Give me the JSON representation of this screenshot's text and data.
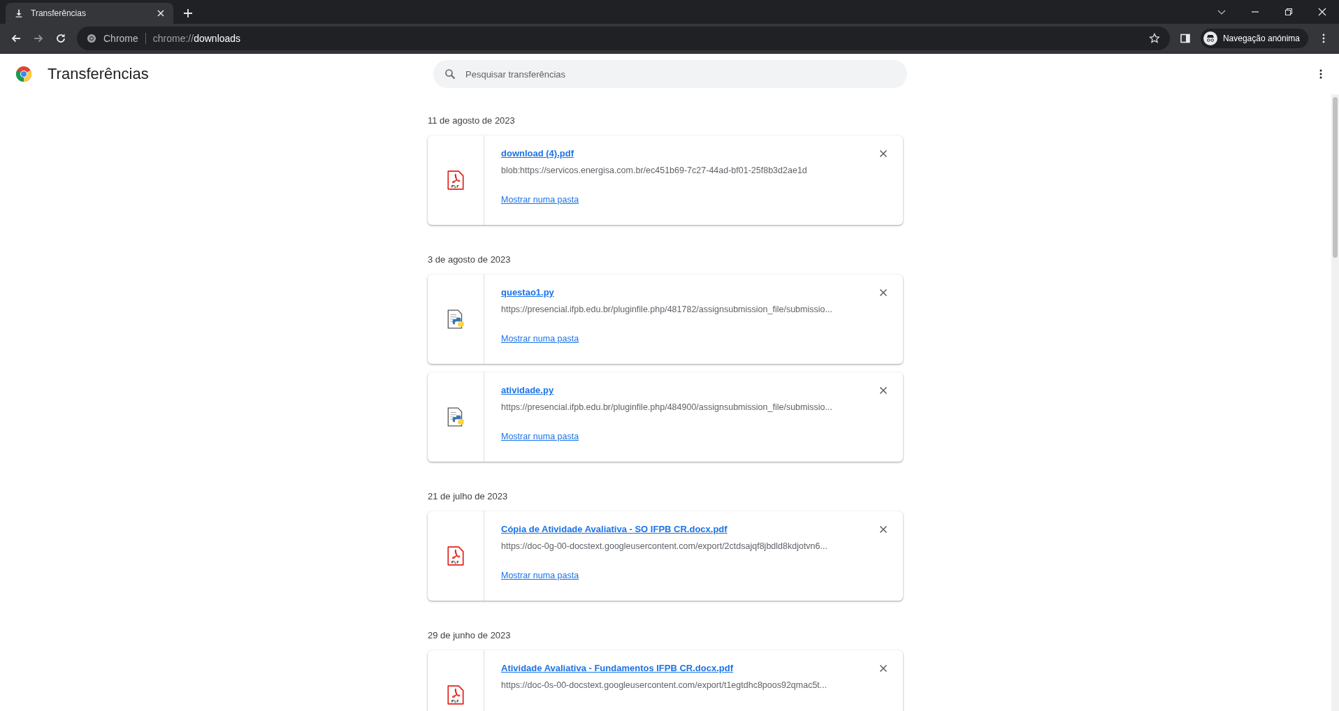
{
  "tab": {
    "title": "Transferências",
    "selected": true
  },
  "address": {
    "site": "Chrome",
    "scheme": "chrome://",
    "path": "downloads"
  },
  "profile": "Navegação anónima",
  "page": {
    "title": "Transferências",
    "search_placeholder": "Pesquisar transferências"
  },
  "groups": [
    {
      "date": "11 de agosto de 2023",
      "items": [
        {
          "kind": "pdf",
          "name": "download (4).pdf",
          "url": "blob:https://servicos.energisa.com.br/ec451b69-7c27-44ad-bf01-25f8b3d2ae1d",
          "show_link": "Mostrar numa pasta"
        }
      ]
    },
    {
      "date": "3 de agosto de 2023",
      "items": [
        {
          "kind": "python",
          "name": "questao1.py",
          "url": "https://presencial.ifpb.edu.br/pluginfile.php/481782/assignsubmission_file/submissio...",
          "show_link": "Mostrar numa pasta"
        },
        {
          "kind": "python",
          "name": "atividade.py",
          "url": "https://presencial.ifpb.edu.br/pluginfile.php/484900/assignsubmission_file/submissio...",
          "show_link": "Mostrar numa pasta"
        }
      ]
    },
    {
      "date": "21 de julho de 2023",
      "items": [
        {
          "kind": "pdf",
          "name": "Cópia de Atividade Avaliativa - SO IFPB CR.docx.pdf",
          "url": "https://doc-0g-00-docstext.googleusercontent.com/export/2ctdsajqf8jbdld8kdjotvn6...",
          "show_link": "Mostrar numa pasta"
        }
      ]
    },
    {
      "date": "29 de junho de 2023",
      "items": [
        {
          "kind": "pdf",
          "name": "Atividade Avaliativa - Fundamentos IFPB CR.docx.pdf",
          "url": "https://doc-0s-00-docstext.googleusercontent.com/export/t1egtdhc8poos92qmac5t..."
        }
      ]
    }
  ]
}
